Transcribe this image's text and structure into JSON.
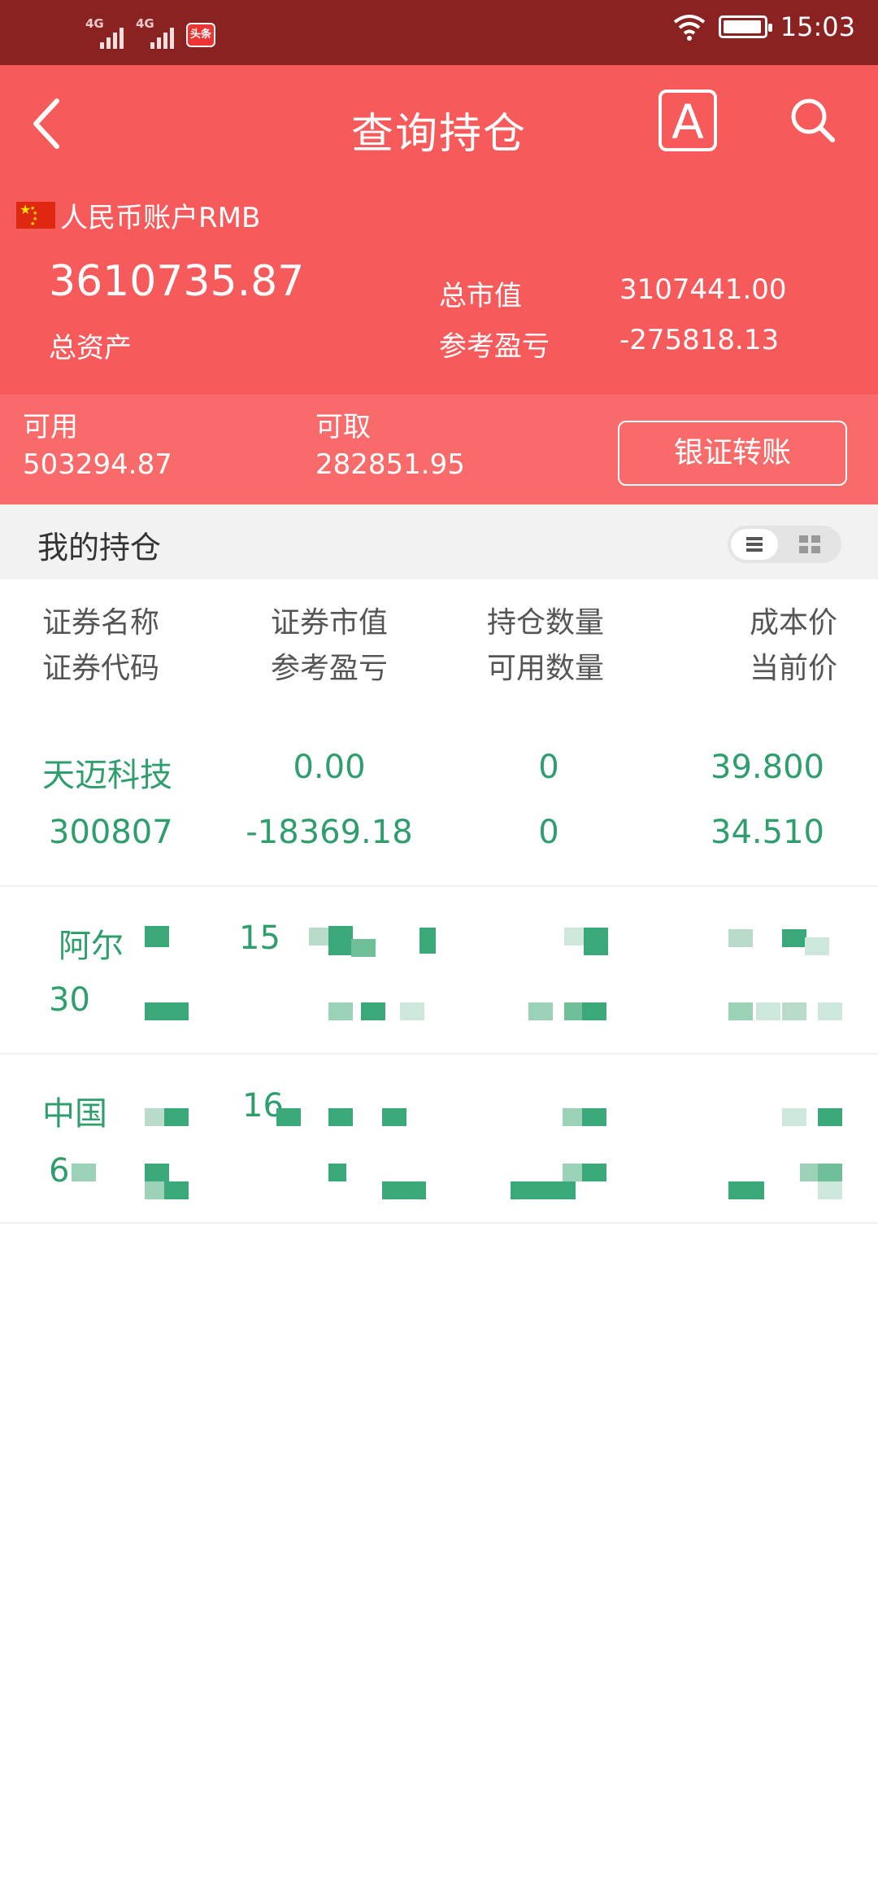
{
  "status_bar": {
    "network_1": "4G",
    "network_2": "4G",
    "news_badge": "头条",
    "time": "15:03"
  },
  "header": {
    "title": "查询持仓",
    "font_button_label": "A",
    "account_label": "人民币账户RMB",
    "total_assets_value": "3610735.87",
    "total_assets_label": "总资产",
    "market_value_label": "总市值",
    "market_value": "3107441.00",
    "ref_pnl_label": "参考盈亏",
    "ref_pnl": "-275818.13"
  },
  "funds": {
    "available_label": "可用",
    "available_value": "503294.87",
    "withdrawable_label": "可取",
    "withdrawable_value": "282851.95",
    "transfer_button": "银证转账"
  },
  "positions": {
    "section_title": "我的持仓",
    "columns": [
      {
        "line1": "证券名称",
        "line2": "证券代码"
      },
      {
        "line1": "证券市值",
        "line2": "参考盈亏"
      },
      {
        "line1": "持仓数量",
        "line2": "可用数量"
      },
      {
        "line1": "成本价",
        "line2": "当前价"
      }
    ],
    "rows": [
      {
        "name": "天迈科技",
        "code": "300807",
        "market_value": "0.00",
        "pnl": "-18369.18",
        "hold_qty": "0",
        "avail_qty": "0",
        "cost_price": "39.800",
        "current_price": "34.510"
      },
      {
        "name": "阿尔",
        "code": "30",
        "market_value": "15",
        "pnl": "",
        "hold_qty": "",
        "avail_qty": "",
        "cost_price": "",
        "current_price": ""
      },
      {
        "name": "中国",
        "code": "6",
        "market_value": "16",
        "pnl": "",
        "hold_qty": "",
        "avail_qty": "",
        "cost_price": "",
        "current_price": ""
      }
    ]
  },
  "colors": {
    "status_bar": "#8b2222",
    "header": "#f75a5a",
    "funds_bar": "#f96b6b",
    "value_green": "#2e9e6c"
  }
}
